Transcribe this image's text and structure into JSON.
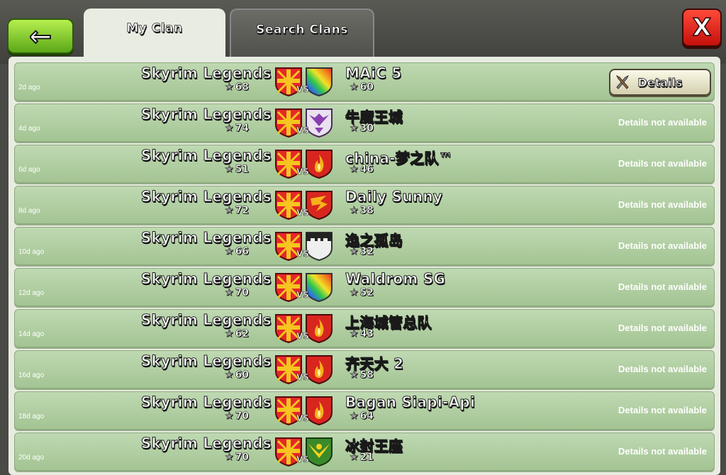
{
  "header": {
    "back_label": "←",
    "close_label": "X",
    "tabs": [
      {
        "label": "My Clan",
        "active": true
      },
      {
        "label": "Search Clans",
        "active": false
      }
    ]
  },
  "details_label": "Details",
  "not_available_label": "Details not available",
  "vs_label": "VS",
  "star_glyph": "★",
  "wars": [
    {
      "ago": "2d ago",
      "my_clan": "Skyrim Legends",
      "my_stars": "68",
      "opponent": "MAiC 5",
      "opp_stars": "60",
      "details": true,
      "opp_badge": "rainbow"
    },
    {
      "ago": "4d ago",
      "my_clan": "Skyrim Legends",
      "my_stars": "74",
      "opponent": "牛魔王城",
      "opp_stars": "30",
      "details": false,
      "opp_badge": "purple-bird"
    },
    {
      "ago": "6d ago",
      "my_clan": "Skyrim Legends",
      "my_stars": "51",
      "opponent": "china-梦之队™",
      "opp_stars": "46",
      "details": false,
      "opp_badge": "red-flame"
    },
    {
      "ago": "8d ago",
      "my_clan": "Skyrim Legends",
      "my_stars": "72",
      "opponent": "Daily Sunny",
      "opp_stars": "38",
      "details": false,
      "opp_badge": "red-dragon"
    },
    {
      "ago": "10d ago",
      "my_clan": "Skyrim Legends",
      "my_stars": "66",
      "opponent": "逸之孤岛",
      "opp_stars": "32",
      "details": false,
      "opp_badge": "black-castle"
    },
    {
      "ago": "12d ago",
      "my_clan": "Skyrim Legends",
      "my_stars": "70",
      "opponent": "Waldrom SG",
      "opp_stars": "52",
      "details": false,
      "opp_badge": "rainbow"
    },
    {
      "ago": "14d ago",
      "my_clan": "Skyrim Legends",
      "my_stars": "62",
      "opponent": "上海城管总队",
      "opp_stars": "43",
      "details": false,
      "opp_badge": "red-flame"
    },
    {
      "ago": "16d ago",
      "my_clan": "Skyrim Legends",
      "my_stars": "60",
      "opponent": "齐天大 2",
      "opp_stars": "58",
      "details": false,
      "opp_badge": "red-flame"
    },
    {
      "ago": "18d ago",
      "my_clan": "Skyrim Legends",
      "my_stars": "70",
      "opponent": "Bagan Siapi-Api",
      "opp_stars": "64",
      "details": false,
      "opp_badge": "red-flame"
    },
    {
      "ago": "20d ago",
      "my_clan": "Skyrim Legends",
      "my_stars": "70",
      "opponent": "冰封王座",
      "opp_stars": "21",
      "details": false,
      "opp_badge": "green-bird"
    }
  ]
}
